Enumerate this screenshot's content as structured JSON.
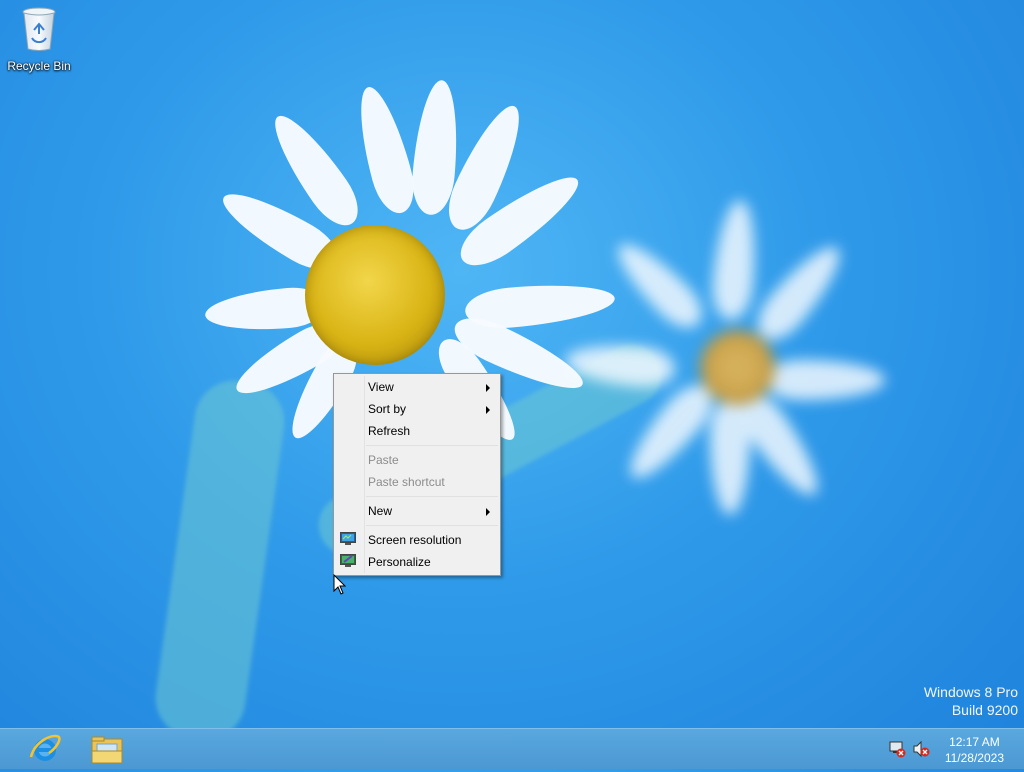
{
  "desktop": {
    "icons": [
      {
        "label": "Recycle Bin",
        "icon": "recycle-bin-icon"
      }
    ]
  },
  "context_menu": {
    "items": [
      {
        "label": "View",
        "submenu": true,
        "enabled": true
      },
      {
        "label": "Sort by",
        "submenu": true,
        "enabled": true
      },
      {
        "label": "Refresh",
        "submenu": false,
        "enabled": true
      },
      {
        "separator": true
      },
      {
        "label": "Paste",
        "submenu": false,
        "enabled": false
      },
      {
        "label": "Paste shortcut",
        "submenu": false,
        "enabled": false
      },
      {
        "separator": true
      },
      {
        "label": "New",
        "submenu": true,
        "enabled": true
      },
      {
        "separator": true
      },
      {
        "label": "Screen resolution",
        "icon": "screen-resolution-icon",
        "enabled": true
      },
      {
        "label": "Personalize",
        "icon": "personalize-icon",
        "enabled": true
      }
    ]
  },
  "watermark": {
    "line1": "Windows 8 Pro",
    "line2": "Build 9200"
  },
  "taskbar": {
    "pinned": [
      {
        "name": "internet-explorer-icon"
      },
      {
        "name": "file-explorer-icon"
      }
    ],
    "tray": {
      "icons": [
        "network-error-icon",
        "volume-muted-icon"
      ],
      "time": "12:17 AM",
      "date": "11/28/2023"
    }
  },
  "colors": {
    "desktop_bg": "#2f9ae9",
    "taskbar": "#4b98d3",
    "menu_bg": "#f0f0f0"
  }
}
